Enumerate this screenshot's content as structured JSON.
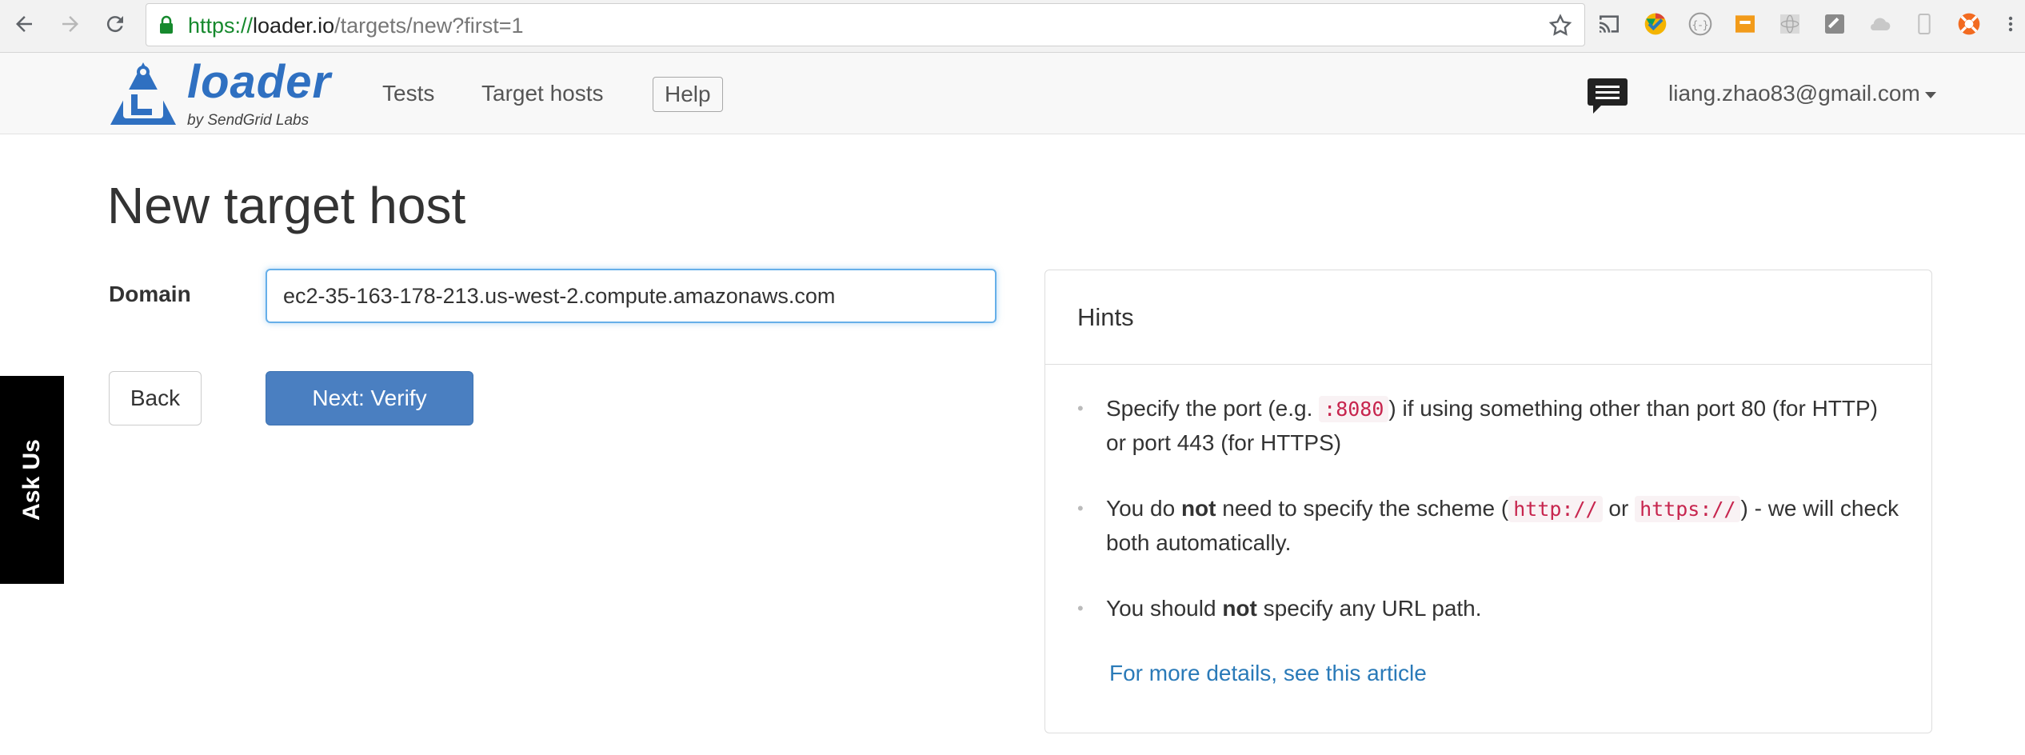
{
  "browser": {
    "url_scheme": "https://",
    "url_host": "loader.io",
    "url_path": "/targets/new?first=1",
    "icons": [
      "back-icon",
      "forward-icon",
      "reload-icon",
      "lock-icon",
      "star-icon",
      "cast-icon",
      "extension-icons",
      "menu-icon"
    ]
  },
  "navbar": {
    "logo_word": "loader",
    "logo_sub": "by SendGrid Labs",
    "tests": "Tests",
    "target_hosts": "Target hosts",
    "help": "Help",
    "user_email": "liang.zhao83@gmail.com"
  },
  "page": {
    "title": "New target host",
    "domain_label": "Domain",
    "domain_value": "ec2-35-163-178-213.us-west-2.compute.amazonaws.com",
    "back_label": "Back",
    "next_label": "Next: Verify",
    "ask_us": "Ask Us"
  },
  "hints": {
    "title": "Hints",
    "items": [
      {
        "parts": [
          "Specify the port (e.g. ",
          ":8080",
          ") if using something other than port 80 (for HTTP) or port 443 (for HTTPS)"
        ]
      },
      {
        "parts": [
          "You do ",
          "not",
          " need to specify the scheme (",
          "http://",
          " or ",
          "https://",
          ") - we will check both automatically."
        ]
      },
      {
        "parts": [
          "You should ",
          "not",
          " specify any URL path."
        ]
      }
    ],
    "link": "For more details, see this article"
  },
  "colors": {
    "brand_blue": "#2f70c1",
    "primary_button": "#4a7fc1",
    "code_red": "#c7254e",
    "link_blue": "#2a7ab8"
  }
}
